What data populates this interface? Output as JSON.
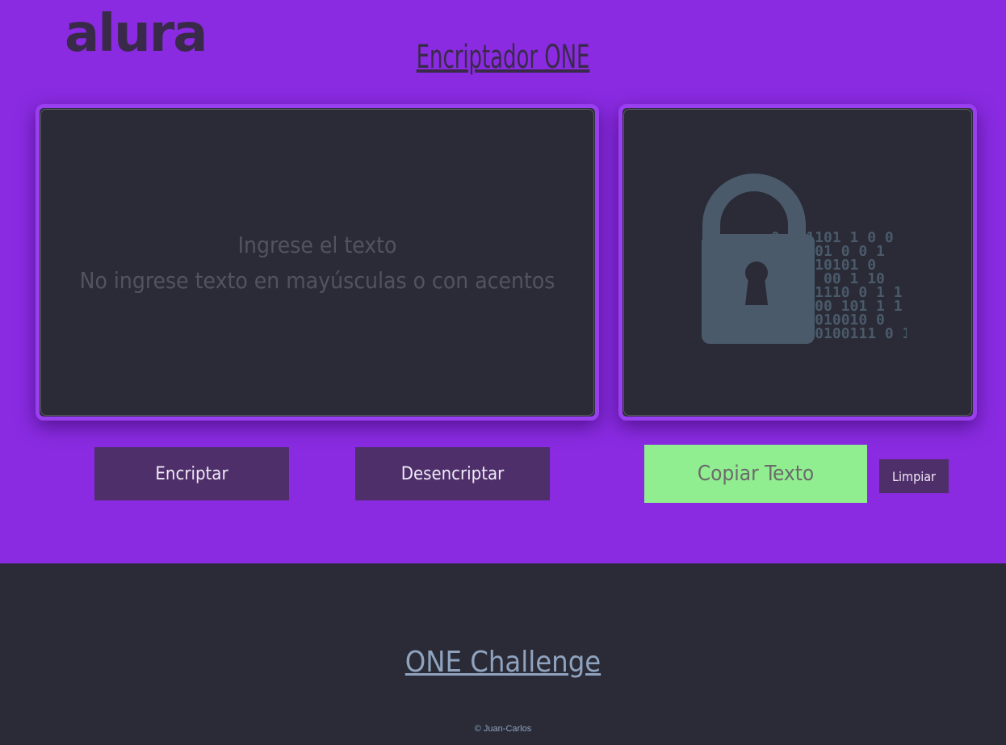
{
  "header": {
    "logo_text": "alura",
    "title": "Encriptador ONE"
  },
  "input": {
    "placeholder": "Ingrese el texto\nNo ingrese texto en mayúsculas o con acentos"
  },
  "output": {
    "image_icon": "padlock-binary-icon",
    "binary_lines": [
      "0 001101 1 0 0",
      "1010101 0 0 1",
      "1 1 110101 0",
      "1 111 00 1 10",
      "0 1001110 0 1 1",
      "00 0100 101 1 1",
      "1 01 010010 0",
      "10 010100111 0 1"
    ]
  },
  "buttons": {
    "encrypt": "Encriptar",
    "decrypt": "Desencriptar",
    "copy": "Copiar Texto",
    "clear": "Limpiar"
  },
  "colors": {
    "background": "#8a2be2",
    "panel": "#2a2b36",
    "button": "#4e2f6a",
    "copy_button": "#90ee90",
    "footer_text": "#8fa3bf"
  },
  "footer": {
    "title": "ONE Challenge",
    "copyright": "© Juan-Carlos"
  }
}
